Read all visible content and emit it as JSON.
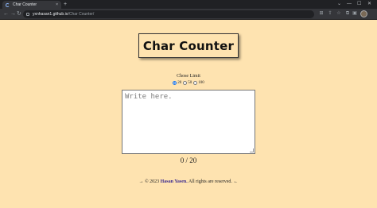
{
  "browser": {
    "tab_title": "Char Counter",
    "tab_close": "×",
    "new_tab": "+",
    "url_host": "yxnhasan1.github.io",
    "url_path": "/Char Counter/",
    "window_controls": [
      "⌄",
      "—",
      "☐",
      "✕"
    ]
  },
  "page": {
    "title": "Char Counter",
    "limit_label": "Chose Limit",
    "limits": [
      {
        "label": "20",
        "checked": true
      },
      {
        "label": "50",
        "checked": false
      },
      {
        "label": "100",
        "checked": false
      }
    ],
    "textarea_placeholder": "Write here.",
    "counter": "0 / 20",
    "footer": {
      "prefix": "→ © 2023",
      "author": "Hasan Yasen.",
      "suffix": "All rights are reserved. ←"
    }
  },
  "colors": {
    "background": "#fee3b0",
    "link": "#3b2a8f"
  }
}
